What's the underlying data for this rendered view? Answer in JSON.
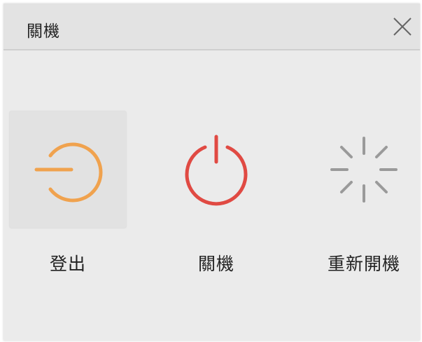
{
  "dialog": {
    "title": "關機",
    "close_icon": "close-icon"
  },
  "options": [
    {
      "label": "登出",
      "icon": "logout-icon",
      "color": "#f0a24e",
      "selected": true
    },
    {
      "label": "關機",
      "icon": "power-icon",
      "color": "#e04a43",
      "selected": false
    },
    {
      "label": "重新開機",
      "icon": "restart-spinner-icon",
      "color": "#9a9a9a",
      "selected": false
    }
  ]
}
